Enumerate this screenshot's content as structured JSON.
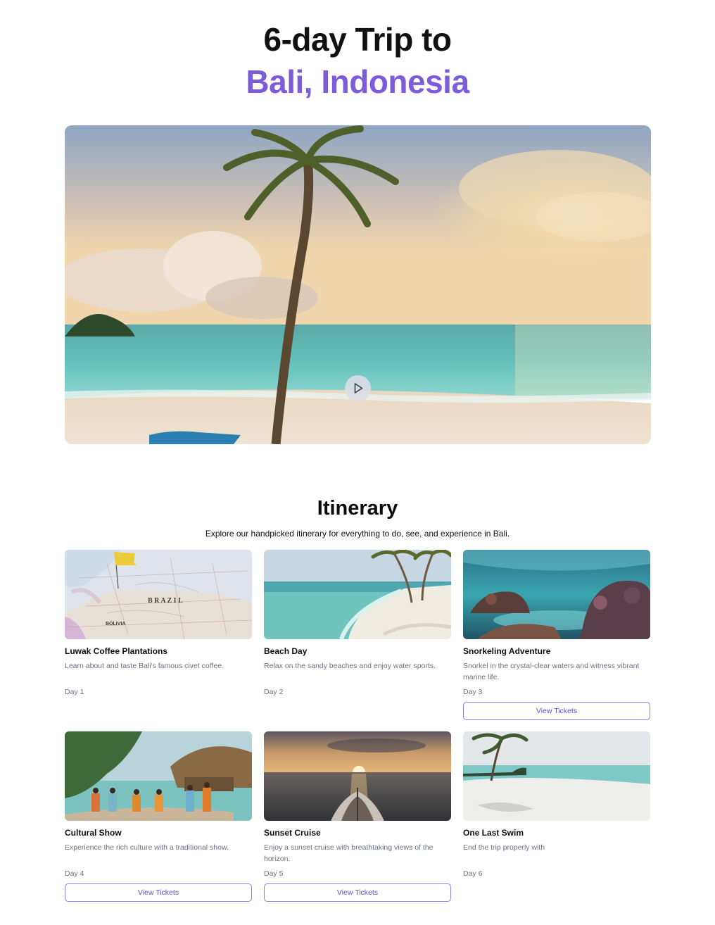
{
  "header": {
    "title_line1": "6-day Trip to",
    "title_line2": "Bali, Indonesia"
  },
  "hero": {
    "image": "beach-sunset-palm",
    "play_icon": "play-icon"
  },
  "itinerary": {
    "title": "Itinerary",
    "subtitle": "Explore our handpicked itinerary for everything to do, see, and experience in Bali.",
    "map_labels": {
      "country": "B R A Z I L",
      "bolivia": "BOLIVIA"
    },
    "cards": [
      {
        "name": "Luwak Coffee Plantations",
        "description": "Learn about and taste Bali's famous civet coffee.",
        "day": "Day 1",
        "button": ""
      },
      {
        "name": "Beach Day",
        "description": "Relax on the sandy beaches and enjoy water sports.",
        "day": "Day 2",
        "button": ""
      },
      {
        "name": "Snorkeling Adventure",
        "description": "Snorkel in the crystal-clear waters and witness vibrant marine life.",
        "day": "Day 3",
        "button": "View Tickets"
      },
      {
        "name": "Cultural Show",
        "description": "Experience the rich culture with a traditional show.",
        "day": "Day 4",
        "button": "View Tickets"
      },
      {
        "name": "Sunset Cruise",
        "description": "Enjoy a sunset cruise with breathtaking views of the horizon.",
        "day": "Day 5",
        "button": "View Tickets"
      },
      {
        "name": "One Last Swim",
        "description": "End the trip properly with",
        "day": "Day 6",
        "button": ""
      }
    ]
  },
  "colors": {
    "accent": "#7c5cd9",
    "button_text": "#5b4fd6",
    "button_border": "#8b80e8"
  }
}
